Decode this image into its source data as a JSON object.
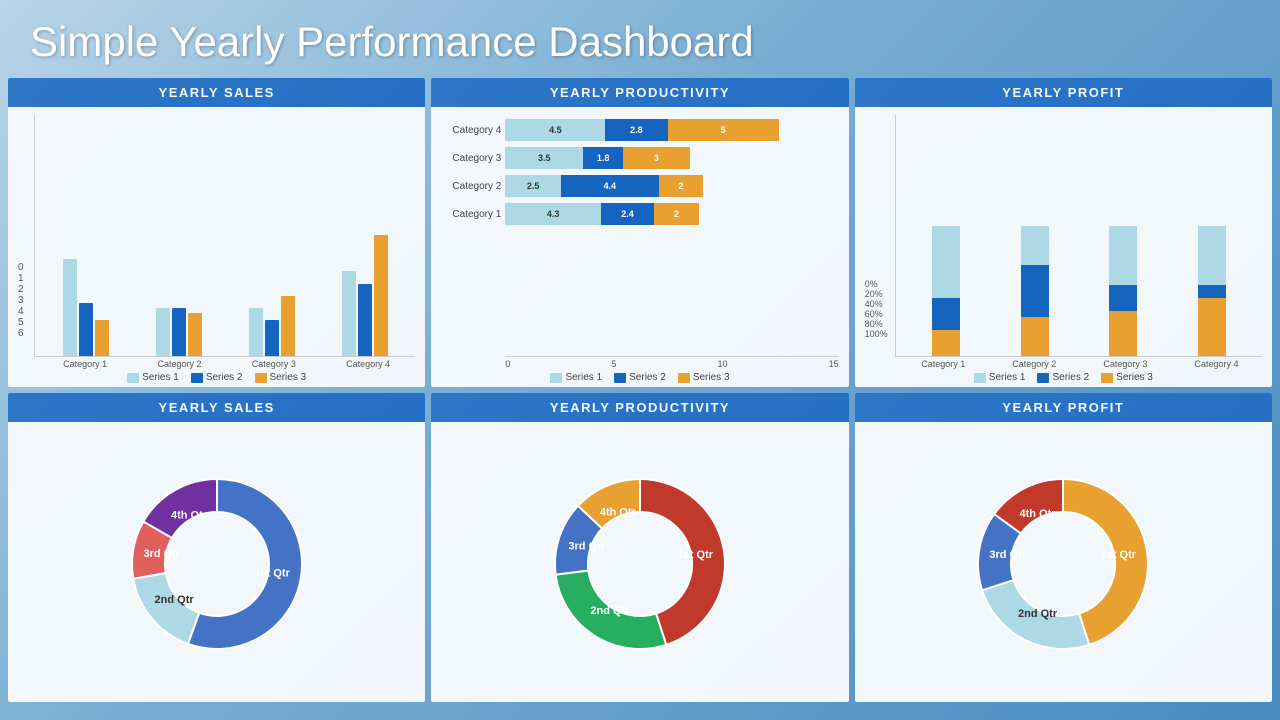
{
  "title": "Simple Yearly Performance Dashboard",
  "colors": {
    "header_bg": "#1565c0",
    "s1": "#add8e6",
    "s2": "#1565c0",
    "s3": "#e8a030",
    "accent": "#1565c0"
  },
  "panels": {
    "top_left": {
      "header": "YEARLY SALES",
      "type": "bar",
      "y_labels": [
        "0",
        "1",
        "2",
        "3",
        "4",
        "5",
        "6"
      ],
      "categories": [
        "Category 1",
        "Category 2",
        "Category 3",
        "Category 4"
      ],
      "series": [
        {
          "name": "Series 1",
          "values": [
            4,
            2,
            2,
            3.5
          ]
        },
        {
          "name": "Series 2",
          "values": [
            2.2,
            2,
            1.5,
            3
          ]
        },
        {
          "name": "Series 3",
          "values": [
            1.5,
            1.8,
            2.5,
            5
          ]
        }
      ],
      "legend": [
        "Series 1",
        "Series 2",
        "Series 3"
      ]
    },
    "top_mid": {
      "header": "YEARLY PRODUCTIVITY",
      "type": "hbar",
      "categories": [
        "Category 1",
        "Category 2",
        "Category 3",
        "Category 4"
      ],
      "data": [
        {
          "label": "Category 4",
          "s1": 4.5,
          "s2": 2.8,
          "s3": 5
        },
        {
          "label": "Category 3",
          "s1": 3.5,
          "s2": 1.8,
          "s3": 3
        },
        {
          "label": "Category 2",
          "s1": 2.5,
          "s2": 4.4,
          "s3": 2
        },
        {
          "label": "Category 1",
          "s1": 4.3,
          "s2": 2.4,
          "s3": 2
        }
      ],
      "x_ticks": [
        "0",
        "5",
        "10",
        "15"
      ],
      "max": 15,
      "legend": [
        "Series 1",
        "Series 2",
        "Series 3"
      ]
    },
    "top_right": {
      "header": "YEARLY PROFIT",
      "type": "stacked",
      "y_labels": [
        "0%",
        "20%",
        "40%",
        "60%",
        "80%",
        "100%"
      ],
      "categories": [
        "Category 1",
        "Category 2",
        "Category 3",
        "Category 4"
      ],
      "data": [
        {
          "s1": 55,
          "s2": 25,
          "s3": 20
        },
        {
          "s1": 30,
          "s2": 40,
          "s3": 30
        },
        {
          "s1": 45,
          "s2": 20,
          "s3": 35
        },
        {
          "s1": 45,
          "s2": 10,
          "s3": 45
        }
      ],
      "legend": [
        "Series 1",
        "Series 2",
        "Series 3"
      ]
    },
    "bot_left": {
      "header": "YEARLY SALES",
      "type": "donut",
      "segments": [
        {
          "label": "1st Qtr",
          "value": 50,
          "color": "#4472c4",
          "text_color": "white"
        },
        {
          "label": "2nd Qtr",
          "value": 15,
          "color": "#add8e6",
          "text_color": "#333"
        },
        {
          "label": "3rd Qtr",
          "value": 10,
          "color": "#e06060",
          "text_color": "white"
        },
        {
          "label": "4th Qtr",
          "value": 15,
          "color": "#7030a0",
          "text_color": "white"
        }
      ]
    },
    "bot_mid": {
      "header": "YEARLY PRODUCTIVITY",
      "type": "donut",
      "segments": [
        {
          "label": "1st Qtr",
          "value": 45,
          "color": "#c0392b",
          "text_color": "white"
        },
        {
          "label": "2nd Qtr",
          "value": 28,
          "color": "#27ae60",
          "text_color": "white"
        },
        {
          "label": "3rd Qtr",
          "value": 14,
          "color": "#4472c4",
          "text_color": "white"
        },
        {
          "label": "4th Qtr",
          "value": 13,
          "color": "#e8a030",
          "text_color": "white"
        }
      ]
    },
    "bot_right": {
      "header": "YEARLY PROFIT",
      "type": "donut",
      "segments": [
        {
          "label": "1st Qtr",
          "value": 45,
          "color": "#e8a030",
          "text_color": "white"
        },
        {
          "label": "2nd Qtr",
          "value": 25,
          "color": "#add8e6",
          "text_color": "#333"
        },
        {
          "label": "3rd Qtr",
          "value": 15,
          "color": "#4472c4",
          "text_color": "white"
        },
        {
          "label": "4th Qtr",
          "value": 15,
          "color": "#c0392b",
          "text_color": "white"
        }
      ]
    }
  },
  "legend": {
    "s1": "Series 1",
    "s2": "Series 2",
    "s3": "Series 3"
  }
}
